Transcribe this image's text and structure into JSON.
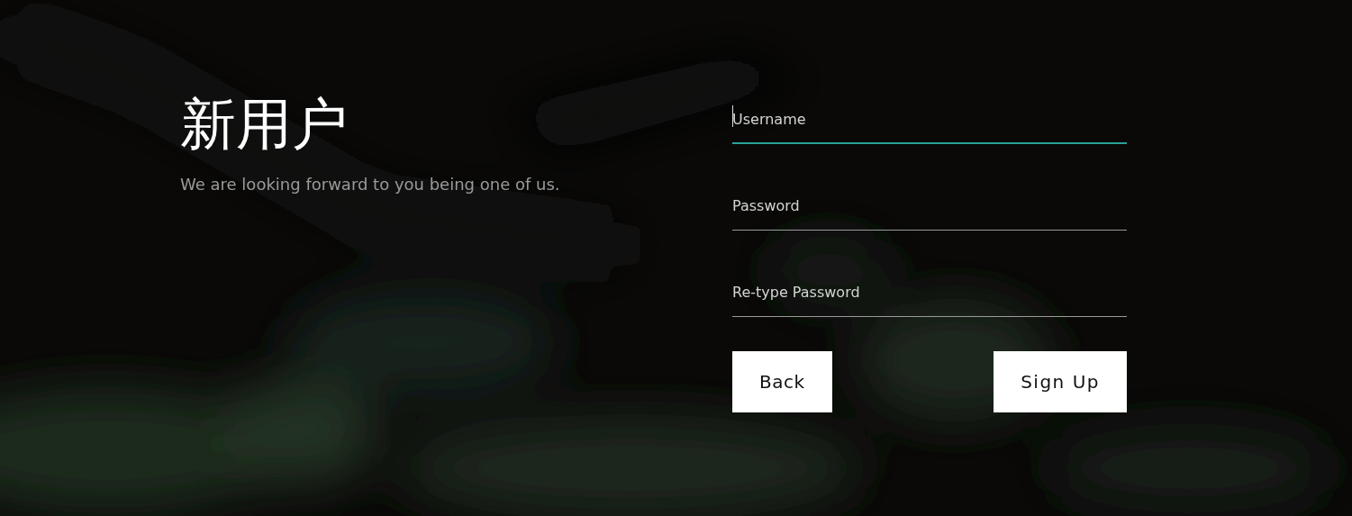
{
  "heading": {
    "title": "新用户",
    "subtitle": "We are looking forward to you being one of us."
  },
  "fields": [
    {
      "placeholder": "Username",
      "focused": true
    },
    {
      "placeholder": "Password",
      "focused": false
    },
    {
      "placeholder": "Re-type Password",
      "focused": false
    }
  ],
  "buttons": [
    {
      "label": "Back",
      "kind": "back"
    },
    {
      "label": "Sign Up",
      "kind": "submit"
    }
  ]
}
